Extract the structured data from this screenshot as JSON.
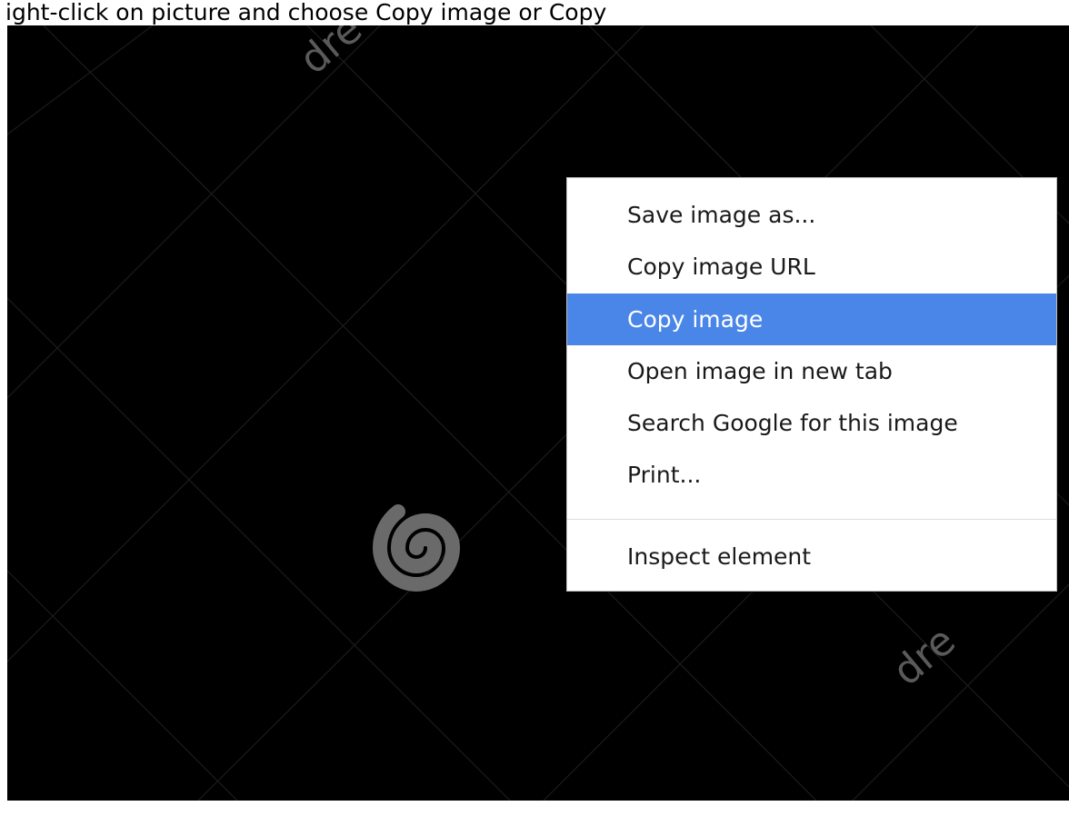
{
  "caption": "ight-click on picture and choose Copy image or Copy",
  "watermark": {
    "text_top": "dre",
    "text_bottom": "dre"
  },
  "context_menu": {
    "items": [
      {
        "label": "Save image as..."
      },
      {
        "label": "Copy image URL"
      },
      {
        "label": "Copy image",
        "highlighted": true
      },
      {
        "label": "Open image in new tab"
      },
      {
        "label": "Search Google for this image"
      },
      {
        "label": "Print..."
      },
      {
        "label": "Inspect element"
      }
    ]
  },
  "colors": {
    "background": "#000000",
    "menu_background": "#ffffff",
    "highlight": "#4a86e8",
    "highlight_text": "#ffffff",
    "menu_text": "#1a1a1a",
    "watermark": "#5a5a5a"
  }
}
